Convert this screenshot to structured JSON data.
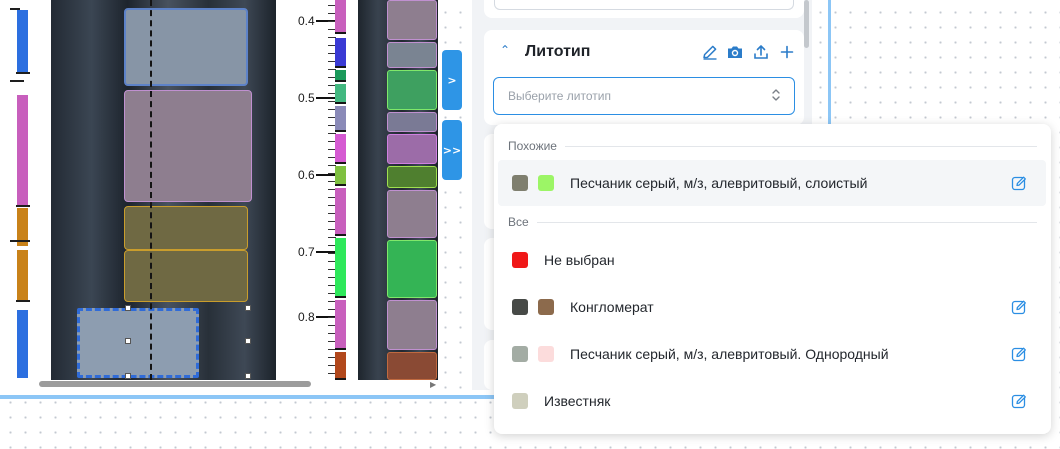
{
  "depth_axis": {
    "labels": [
      "0.4",
      "0.5",
      "0.6",
      "0.7",
      "0.8"
    ]
  },
  "nav": {
    "expand_label": ">",
    "expand_all_label": ">>"
  },
  "lithotype_panel": {
    "title": "Литотип",
    "select_placeholder": "Выберите литотип",
    "tools": [
      "edit-icon",
      "camera-icon",
      "upload-icon",
      "plus-icon"
    ]
  },
  "dropdown": {
    "similar_group": {
      "label": "Похожие",
      "items": [
        {
          "label": "Песчаник серый, м/з, алевритовый, слоистый",
          "swatches": [
            "#7f7f6f",
            "#9cf566"
          ],
          "editable": true,
          "hovered": true
        }
      ]
    },
    "all_group": {
      "label": "Все",
      "items": [
        {
          "label": "Не выбран",
          "swatches": [
            "#f01818"
          ],
          "editable": false
        },
        {
          "label": "Конгломерат",
          "swatches": [
            "#474a47",
            "#8c6a4c"
          ],
          "editable": true
        },
        {
          "label": "Песчаник серый, м/з, алевритовый. Однородный",
          "swatches": [
            "#a3aca4",
            "#fcdcdc"
          ],
          "editable": true
        },
        {
          "label": "Известняк",
          "swatches": [
            "#cfcfbd"
          ],
          "editable": true
        }
      ]
    }
  },
  "colors": {
    "accent": "#2b8ee3",
    "selection": "#2f6bd8"
  }
}
